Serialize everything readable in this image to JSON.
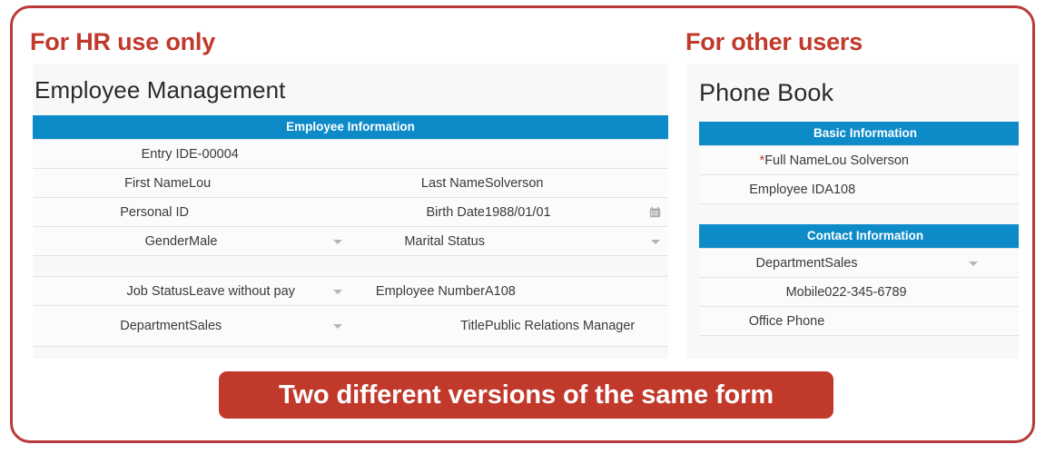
{
  "frame": {
    "border_color": "#b93a3a",
    "accent_red": "#c0392b",
    "accent_blue": "#0c8bc8"
  },
  "callouts": {
    "left": "For HR use only",
    "right": "For other users"
  },
  "left_panel": {
    "title": "Employee Management",
    "sections": [
      {
        "header": "Employee Information",
        "rows": [
          [
            {
              "label": "Entry ID",
              "value": "E-00004",
              "control": "text",
              "span": 3
            }
          ],
          [
            {
              "label": "First Name",
              "value": "Lou",
              "control": "text"
            },
            {
              "label": "Last Name",
              "value": "Solverson",
              "control": "text"
            }
          ],
          [
            {
              "label": "Personal ID",
              "value": "",
              "control": "text"
            },
            {
              "label": "Birth Date",
              "value": "1988/01/01",
              "control": "date"
            }
          ],
          [
            {
              "label": "Gender",
              "value": "Male",
              "control": "select"
            },
            {
              "label": "Marital Status",
              "value": "",
              "control": "select"
            }
          ]
        ]
      },
      {
        "header": "",
        "rows": [
          [
            {
              "label": "Job Status",
              "value": "Leave without pay",
              "control": "select"
            },
            {
              "label": "Employee Number",
              "value": "A108",
              "control": "text"
            }
          ],
          [
            {
              "label": "Department",
              "value": "Sales",
              "control": "select"
            },
            {
              "label": "Title",
              "value": "Public Relations Manager",
              "control": "text"
            }
          ]
        ]
      }
    ]
  },
  "right_panel": {
    "title": "Phone Book",
    "sections": [
      {
        "header": "Basic Information",
        "rows": [
          {
            "label": "Full Name",
            "required": true,
            "value": "Lou Solverson",
            "control": "text"
          },
          {
            "label": "Employee ID",
            "required": false,
            "value": "A108",
            "control": "text"
          }
        ]
      },
      {
        "header": "Contact Information",
        "rows": [
          {
            "label": "Department",
            "required": false,
            "value": "Sales",
            "control": "select"
          },
          {
            "label": "Mobile",
            "required": false,
            "value": "022-345-6789",
            "control": "link"
          },
          {
            "label": "Office Phone",
            "required": false,
            "value": "",
            "control": "text"
          }
        ]
      }
    ]
  },
  "banner": {
    "text": "Two different versions of the same form"
  },
  "icons": {
    "calendar": "Ὄ5",
    "caret_down": "▾"
  }
}
